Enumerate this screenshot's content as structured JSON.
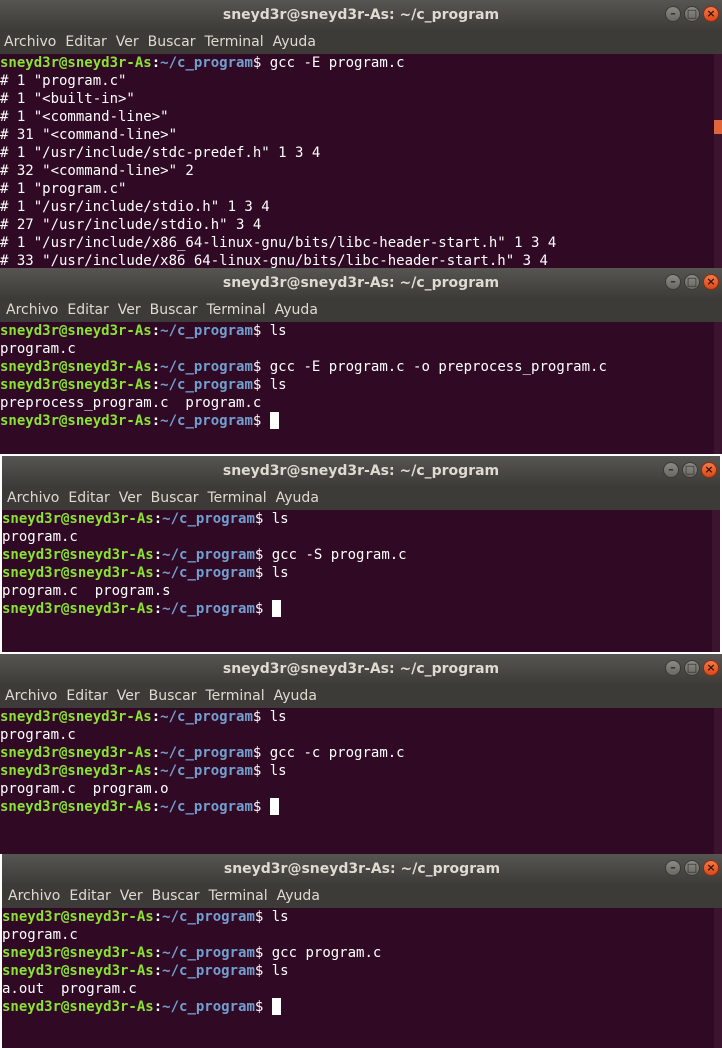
{
  "prompt": {
    "user": "sneyd3r@sneyd3r-As",
    "colon": ":",
    "path": "~/c_program",
    "dollar": "$"
  },
  "windows": [
    {
      "title": "sneyd3r@sneyd3r-As: ~/c_program",
      "menu": [
        "Archivo",
        "Editar",
        "Ver",
        "Buscar",
        "Terminal",
        "Ayuda"
      ],
      "lines": [
        {
          "type": "prompt",
          "cmd": " gcc -E program.c"
        },
        {
          "type": "out",
          "text": "# 1 \"program.c\""
        },
        {
          "type": "out",
          "text": "# 1 \"<built-in>\""
        },
        {
          "type": "out",
          "text": "# 1 \"<command-line>\""
        },
        {
          "type": "out",
          "text": "# 31 \"<command-line>\""
        },
        {
          "type": "out",
          "text": "# 1 \"/usr/include/stdc-predef.h\" 1 3 4"
        },
        {
          "type": "out",
          "text": "# 32 \"<command-line>\" 2"
        },
        {
          "type": "out",
          "text": "# 1 \"program.c\""
        },
        {
          "type": "out",
          "text": "# 1 \"/usr/include/stdio.h\" 1 3 4"
        },
        {
          "type": "out",
          "text": "# 27 \"/usr/include/stdio.h\" 3 4"
        },
        {
          "type": "out",
          "text": "# 1 \"/usr/include/x86_64-linux-gnu/bits/libc-header-start.h\" 1 3 4"
        },
        {
          "type": "out",
          "text": "# 33 \"/usr/include/x86_64-linux-gnu/bits/libc-header-start.h\" 3 4"
        }
      ]
    },
    {
      "title": "sneyd3r@sneyd3r-As: ~/c_program",
      "menu": [
        "Archivo",
        "Editar",
        "Ver",
        "Buscar",
        "Terminal",
        "Ayuda"
      ],
      "lines": [
        {
          "type": "prompt",
          "cmd": " ls"
        },
        {
          "type": "out",
          "text": "program.c"
        },
        {
          "type": "prompt",
          "cmd": " gcc -E program.c -o preprocess_program.c"
        },
        {
          "type": "prompt",
          "cmd": " ls"
        },
        {
          "type": "out",
          "text": "preprocess_program.c  program.c"
        },
        {
          "type": "prompt",
          "cmd": " ",
          "cursor": true
        }
      ]
    },
    {
      "title": "sneyd3r@sneyd3r-As: ~/c_program",
      "menu": [
        "Archivo",
        "Editar",
        "Ver",
        "Buscar",
        "Terminal",
        "Ayuda"
      ],
      "lines": [
        {
          "type": "prompt",
          "cmd": " ls"
        },
        {
          "type": "out",
          "text": "program.c"
        },
        {
          "type": "prompt",
          "cmd": " gcc -S program.c"
        },
        {
          "type": "prompt",
          "cmd": " ls"
        },
        {
          "type": "out",
          "text": "program.c  program.s"
        },
        {
          "type": "prompt",
          "cmd": " ",
          "cursor": true
        }
      ]
    },
    {
      "title": "sneyd3r@sneyd3r-As: ~/c_program",
      "menu": [
        "Archivo",
        "Editar",
        "Ver",
        "Buscar",
        "Terminal",
        "Ayuda"
      ],
      "lines": [
        {
          "type": "prompt",
          "cmd": " ls"
        },
        {
          "type": "out",
          "text": "program.c"
        },
        {
          "type": "prompt",
          "cmd": " gcc -c program.c"
        },
        {
          "type": "prompt",
          "cmd": " ls"
        },
        {
          "type": "out",
          "text": "program.c  program.o"
        },
        {
          "type": "prompt",
          "cmd": " ",
          "cursor": true
        }
      ]
    },
    {
      "title": "sneyd3r@sneyd3r-As: ~/c_program",
      "menu": [
        "Archivo",
        "Editar",
        "Ver",
        "Buscar",
        "Terminal",
        "Ayuda"
      ],
      "lines": [
        {
          "type": "prompt",
          "cmd": " ls"
        },
        {
          "type": "out",
          "text": "program.c"
        },
        {
          "type": "prompt",
          "cmd": " gcc program.c"
        },
        {
          "type": "prompt",
          "cmd": " ls"
        },
        {
          "type": "out",
          "text": "a.out  program.c"
        },
        {
          "type": "prompt",
          "cmd": " ",
          "cursor": true
        }
      ]
    }
  ]
}
